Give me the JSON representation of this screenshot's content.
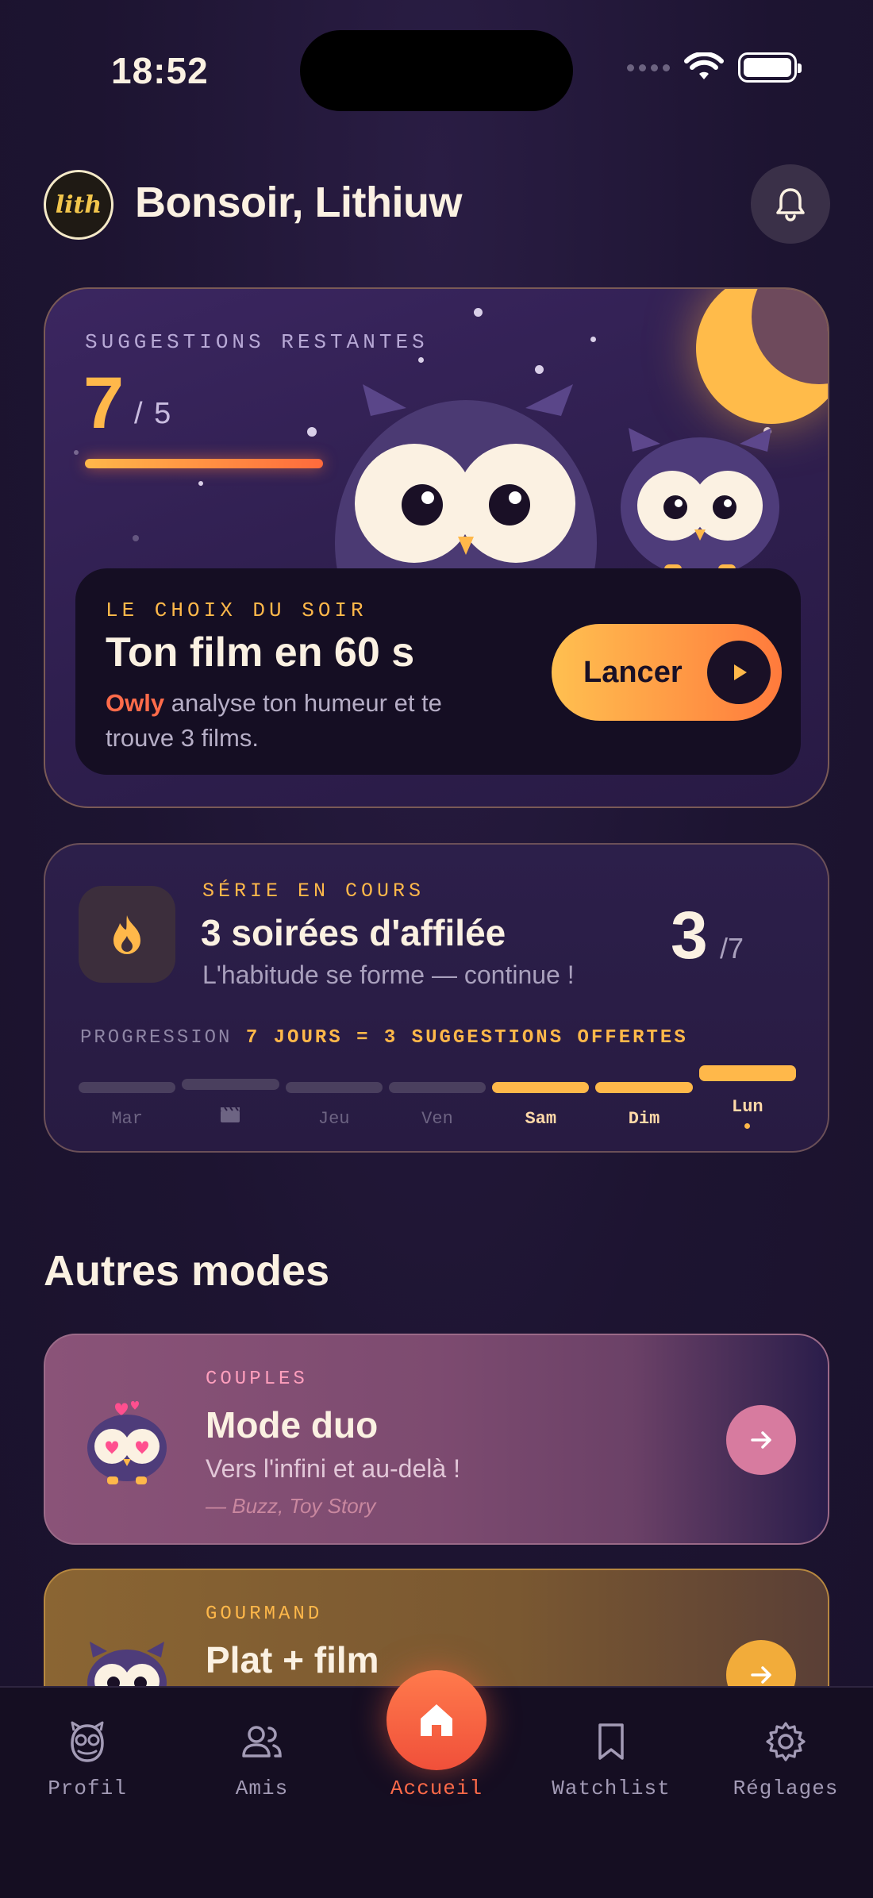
{
  "status": {
    "time": "18:52"
  },
  "header": {
    "avatar_text": "lith",
    "greeting": "Bonsoir, Lithiuw"
  },
  "hero": {
    "kicker": "SUGGESTIONS RESTANTES",
    "count": "7",
    "total": "/ 5",
    "progress_fraction": 1.0,
    "inner": {
      "kicker": "LE CHOIX DU SOIR",
      "title": "Ton film en 60 s",
      "desc_highlight": "Owly",
      "desc_rest": " analyse ton humeur et te trouve 3 films.",
      "button_label": "Lancer"
    }
  },
  "streak": {
    "kicker": "SÉRIE EN COURS",
    "title": "3 soirées d'affilée",
    "subtitle": "L'habitude se forme — continue !",
    "count": "3",
    "of": "/7",
    "progress_label": "PROGRESSION",
    "progress_highlight": "7 JOURS = 3 SUGGESTIONS OFFERTES",
    "days": [
      {
        "label": "Mar",
        "done": false
      },
      {
        "label": "",
        "done": false,
        "icon": "film-clapper-icon"
      },
      {
        "label": "Jeu",
        "done": false
      },
      {
        "label": "Ven",
        "done": false
      },
      {
        "label": "Sam",
        "done": true
      },
      {
        "label": "Dim",
        "done": true
      },
      {
        "label": "Lun",
        "done": true,
        "today": true
      }
    ]
  },
  "modes": {
    "title": "Autres modes",
    "duo": {
      "kicker": "COUPLES",
      "title": "Mode duo",
      "subtitle": "Vers l'infini et au-delà !",
      "quote": "— Buzz, Toy Story"
    },
    "food": {
      "kicker": "GOURMAND",
      "title": "Plat + film"
    }
  },
  "tabbar": {
    "items": [
      {
        "label": "Profil",
        "icon": "owl-profile-icon"
      },
      {
        "label": "Amis",
        "icon": "users-icon"
      },
      {
        "label": "Accueil",
        "icon": "home-icon",
        "active": true
      },
      {
        "label": "Watchlist",
        "icon": "bookmark-icon"
      },
      {
        "label": "Réglages",
        "icon": "gear-icon"
      }
    ]
  },
  "colors": {
    "accent": "#ffb84a",
    "accent_red": "#ff6b4a",
    "background": "#1c1330",
    "duo_pink": "#d77b9f"
  }
}
